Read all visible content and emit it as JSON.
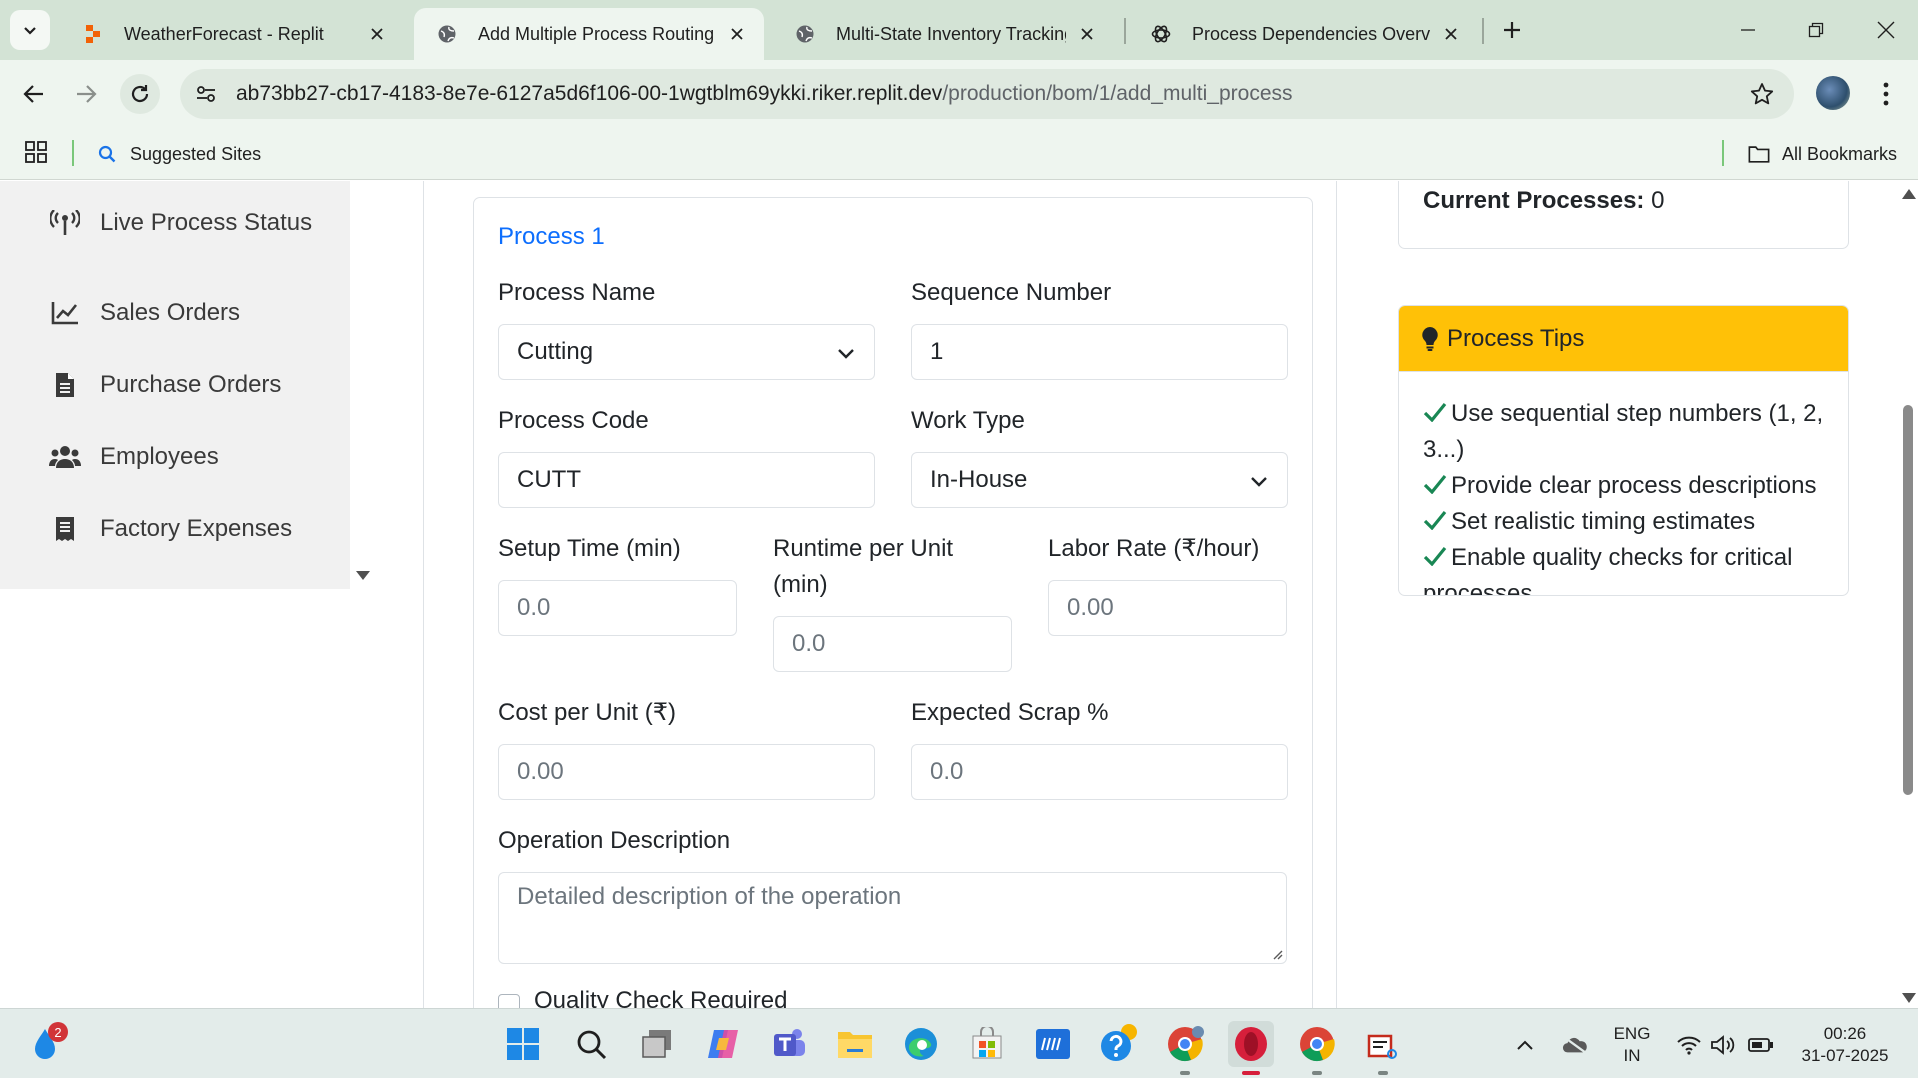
{
  "browser": {
    "tabs": [
      {
        "title": "WeatherForecast - Replit",
        "icon": "replit-icon",
        "active": false
      },
      {
        "title": "Add Multiple Process Routing -",
        "icon": "globe-icon",
        "active": true
      },
      {
        "title": "Multi-State Inventory Tracking",
        "icon": "globe-icon",
        "active": false
      },
      {
        "title": "Process Dependencies Overview",
        "icon": "openai-icon",
        "active": false
      }
    ],
    "url_host": "ab73bb27-cb17-4183-8e7e-6127a5d6f106-00-1wgtblm69ykki.riker.replit.dev",
    "url_path": "/production/bom/1/add_multi_process",
    "bookmarks": {
      "suggested": "Suggested Sites",
      "all": "All Bookmarks"
    }
  },
  "sidebar": {
    "items": [
      {
        "label": "Live Process Status",
        "icon": "broadcast-icon"
      },
      {
        "label": "Sales Orders",
        "icon": "line-chart-icon"
      },
      {
        "label": "Purchase Orders",
        "icon": "document-icon"
      },
      {
        "label": "Employees",
        "icon": "users-icon"
      },
      {
        "label": "Factory Expenses",
        "icon": "receipt-icon"
      }
    ]
  },
  "form": {
    "heading": "Process 1",
    "process_name": {
      "label": "Process Name",
      "value": "Cutting"
    },
    "sequence_number": {
      "label": "Sequence Number",
      "value": "1"
    },
    "process_code": {
      "label": "Process Code",
      "value": "CUTT"
    },
    "work_type": {
      "label": "Work Type",
      "value": "In-House"
    },
    "setup_time": {
      "label": "Setup Time (min)",
      "placeholder": "0.0"
    },
    "runtime_per_unit": {
      "label_line1": "Runtime per Unit",
      "label_line2": "(min)",
      "placeholder": "0.0"
    },
    "labor_rate": {
      "label": "Labor Rate (₹/hour)",
      "placeholder": "0.00"
    },
    "cost_per_unit": {
      "label": "Cost per Unit (₹)",
      "placeholder": "0.00"
    },
    "expected_scrap": {
      "label": "Expected Scrap %",
      "placeholder": "0.0"
    },
    "operation_description": {
      "label": "Operation Description",
      "placeholder": "Detailed description of the operation"
    },
    "quality_check": {
      "label": "Quality Check Required"
    }
  },
  "summary": {
    "current_label": "Current Processes:",
    "current_value": "0"
  },
  "tips": {
    "title": "Process Tips",
    "items": [
      "Use sequential step numbers (1, 2, 3...)",
      "Provide clear process descriptions",
      "Set realistic timing estimates",
      "Enable quality checks for critical processes"
    ]
  },
  "taskbar": {
    "notification_count": "2",
    "language_line1": "ENG",
    "language_line2": "IN",
    "time": "00:26",
    "date": "31-07-2025"
  },
  "colors": {
    "accent": "#0d6efd",
    "tips_header": "#ffc107",
    "check": "#198754",
    "tab_strip": "#d3e3d5"
  }
}
